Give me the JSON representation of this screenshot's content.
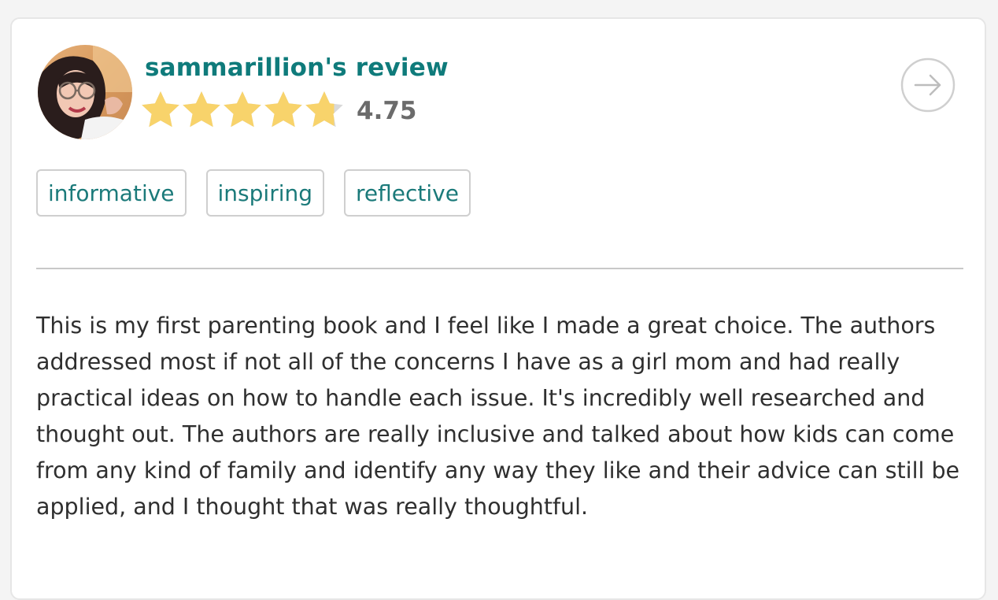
{
  "review": {
    "title": "sammarillion's review",
    "rating": 4.75,
    "rating_text": "4.75",
    "star_color": "#f8d36b",
    "star_empty_color": "#d9d9d9",
    "accent_color": "#0f7b7b",
    "avatar_icon": "user-avatar-photo",
    "next_icon": "arrow-right-circle-icon",
    "tags": [
      "informative",
      "inspiring",
      "reflective"
    ],
    "body": "This is my first parenting book and I feel like I made a great choice. The authors addressed most if not all of the concerns I have as a girl mom and had really practical ideas on how to handle each issue. It's incredibly well researched and thought out. The authors are really inclusive and talked about how kids can come from any kind of family and identify any way they like and their advice can still be applied, and I thought that was really thoughtful."
  }
}
